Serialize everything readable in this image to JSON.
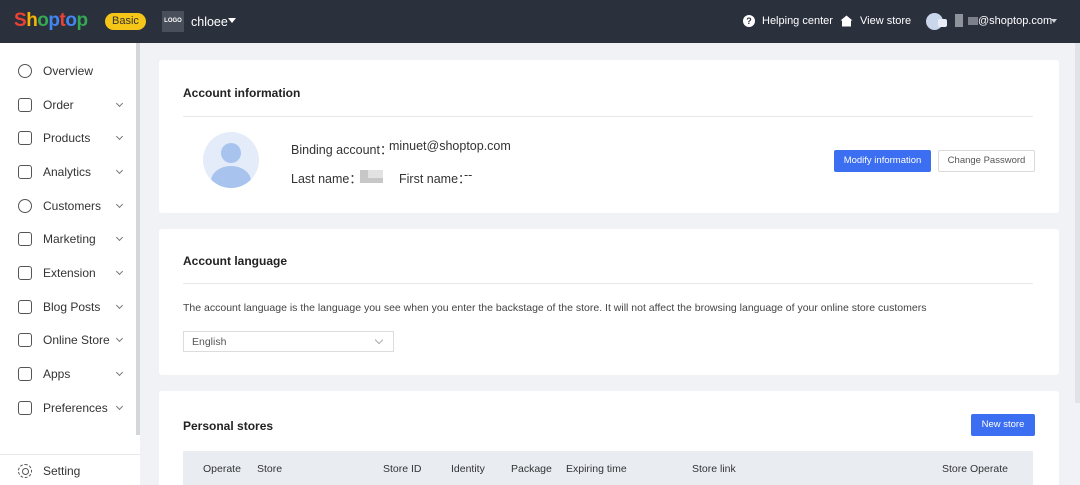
{
  "colors": {
    "topbar": "#2b303d",
    "primary": "#3b6ef0",
    "badge": "#f5c518",
    "background": "#f0f2f5"
  },
  "topbar": {
    "logo_letters": [
      "S",
      "h",
      "o",
      "p",
      "t",
      "o",
      "p"
    ],
    "logo_colors": [
      "#e94235",
      "#f4b400",
      "#34a853",
      "#4285f4",
      "#e94235",
      "#4285f4",
      "#34a853"
    ],
    "plan_badge": "Basic",
    "store_logo_text": "LOGO",
    "store_name": "chloee",
    "help_label": "Helping center",
    "view_store_label": "View store",
    "user_email": "@shoptop.com"
  },
  "sidebar": {
    "items": [
      {
        "label": "Overview",
        "icon": "compass-icon",
        "has_chevron": false
      },
      {
        "label": "Order",
        "icon": "order-icon",
        "has_chevron": true
      },
      {
        "label": "Products",
        "icon": "products-icon",
        "has_chevron": true
      },
      {
        "label": "Analytics",
        "icon": "analytics-icon",
        "has_chevron": true
      },
      {
        "label": "Customers",
        "icon": "customers-icon",
        "has_chevron": true
      },
      {
        "label": "Marketing",
        "icon": "marketing-icon",
        "has_chevron": true
      },
      {
        "label": "Extension",
        "icon": "extension-icon",
        "has_chevron": true
      },
      {
        "label": "Blog Posts",
        "icon": "blog-icon",
        "has_chevron": true
      },
      {
        "label": "Online Store",
        "icon": "online-store-icon",
        "has_chevron": true
      },
      {
        "label": "Apps",
        "icon": "apps-icon",
        "has_chevron": true
      },
      {
        "label": "Preferences",
        "icon": "preferences-icon",
        "has_chevron": true
      }
    ],
    "setting_label": "Setting"
  },
  "account_info": {
    "title": "Account information",
    "binding_label": "Binding account：",
    "binding_value": "minuet@shoptop.com",
    "last_name_label": "Last name：",
    "first_name_label": "First name：",
    "first_name_value": "--",
    "modify_button": "Modify information",
    "change_password_button": "Change Password"
  },
  "account_language": {
    "title": "Account language",
    "description": "The account language is the language you see when you enter the backstage of the store. It will not affect the browsing language of your online store customers",
    "selected": "English"
  },
  "personal_stores": {
    "title": "Personal stores",
    "new_store_button": "New store",
    "columns": [
      "Operate",
      "Store",
      "Store ID",
      "Identity",
      "Package",
      "Expiring time",
      "Store link",
      "Store Operate"
    ]
  }
}
